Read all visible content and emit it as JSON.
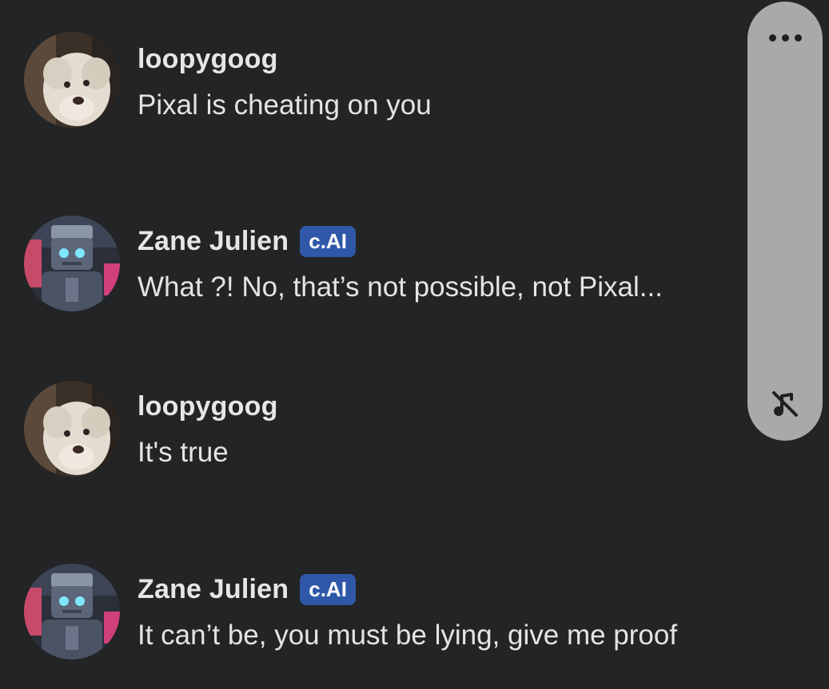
{
  "messages": [
    {
      "sender": "loopygoog",
      "badge": "",
      "text": "Pixal is cheating on you",
      "avatar": "dog-avatar"
    },
    {
      "sender": "Zane Julien",
      "badge": "c.AI",
      "text": "What ?! No, that’s not possible, not Pixal...",
      "avatar": "robot-avatar"
    },
    {
      "sender": "loopygoog",
      "badge": "",
      "text": "It's true",
      "avatar": "dog-avatar"
    },
    {
      "sender": "Zane Julien",
      "badge": "c.AI",
      "text": "It can’t be, you must be lying, give me proof",
      "avatar": "robot-avatar"
    }
  ],
  "side_panel": {
    "more_icon": "more-horizontal-icon",
    "mute_icon": "music-off-icon"
  },
  "colors": {
    "background": "#232425",
    "badge": "#2f58a8",
    "panel": "#a9a9a9"
  }
}
